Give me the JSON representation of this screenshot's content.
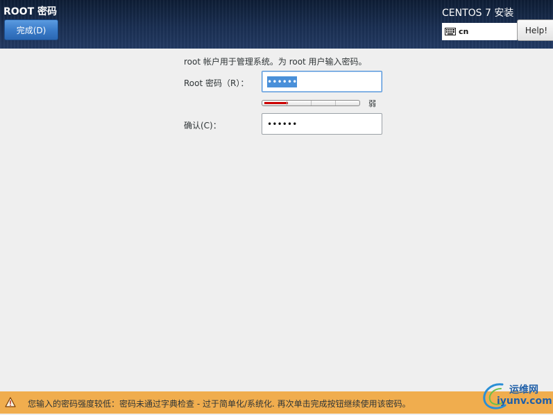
{
  "header": {
    "spoke_title": "ROOT 密码",
    "done_button": "完成(D)",
    "product_title": "CENTOS 7 安装",
    "keyboard_layout": "cn",
    "help_button": "Help!"
  },
  "main": {
    "description": "root 帐户用于管理系统。为 root 用户输入密码。",
    "root_password_label": "Root 密码（R）：",
    "root_password_value": "••••••",
    "strength_fraction": 0.25,
    "strength_label": "弱",
    "confirm_label": "确认(C)：",
    "confirm_value": "••••••"
  },
  "warning": {
    "message": "您输入的密码强度较低：密码未通过字典检查 - 过于简单化/系统化. 再次单击完成按钮继续使用该密码。"
  },
  "watermark": {
    "name": "运维网",
    "domain": "iyunv.com"
  },
  "colors": {
    "header_bg": "#1a2f52",
    "done_button": "#3b7cc9",
    "warning_bar": "#f0ad4e",
    "strength_weak": "#cc0000",
    "selection": "#4a90d9"
  }
}
